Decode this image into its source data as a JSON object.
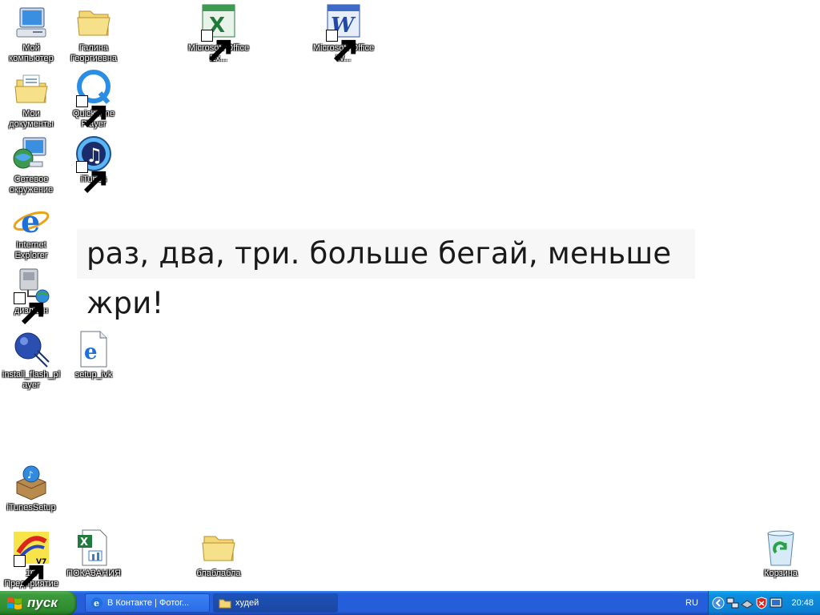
{
  "desktop": {
    "wallpaper_text": "раз, два, три. больше бегай, меньше жри!",
    "icons": {
      "my_computer": "Мой компьютер",
      "galina": "Галина Георгиевна",
      "excel": "Microsoft Office Ex...",
      "word": "Microsoft Office W...",
      "my_documents": "Мои документы",
      "quicktime": "QuickTime Player",
      "network": "Сетевое окружение",
      "itunes": "iTunes",
      "ie": "Internet Explorer",
      "dialup": "дизлайн",
      "flash": "install_flash_pl ayer",
      "setup_ivk": "setup_ivk",
      "itunessetup": "iTunesSetup",
      "onec": "1С Предприятие",
      "pokazaniya": "ПОКАЗАНИЯ",
      "blabla": "блаблабла",
      "recycle": "Корзина"
    }
  },
  "taskbar": {
    "start_label": "пуск",
    "tasks": [
      {
        "label": "В Контакте | Фотог..."
      },
      {
        "label": "худей"
      }
    ],
    "language": "RU",
    "clock": "20:48"
  },
  "colors": {
    "taskbar": "#245edb",
    "start": "#3d9a3d",
    "tray": "#0b7fd2"
  }
}
